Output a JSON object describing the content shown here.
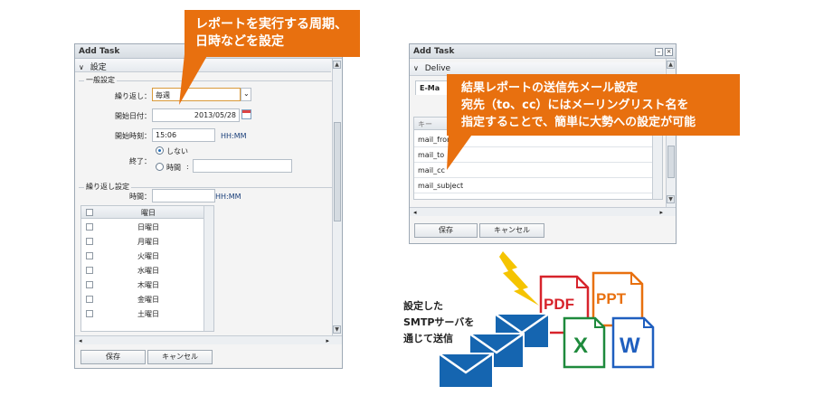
{
  "left_window": {
    "title": "Add Task",
    "section_header": "設定",
    "general_legend": "一般設定",
    "repeat_label": "繰り返し：",
    "repeat_value": "毎週",
    "start_date_label": "開始日付：",
    "start_date_value": "2013/05/28",
    "start_time_label": "開始時刻：",
    "start_time_value": "15:06",
    "time_unit": "HH:MM",
    "end_label": "終了：",
    "end_option_none": "しない",
    "end_option_time": "時間",
    "end_option_time_sep": ":",
    "repeat_settings_legend": "繰り返し設定",
    "interval_label": "時間：",
    "interval_unit": "HH:MM",
    "weekday_header": "曜日",
    "weekdays": [
      "日曜日",
      "月曜日",
      "火曜日",
      "水曜日",
      "木曜日",
      "金曜日",
      "土曜日"
    ],
    "save_button": "保存",
    "cancel_button": "キャンセル"
  },
  "right_window": {
    "title": "Add Task",
    "section_header": "Delive",
    "tab_label": "E-Ma",
    "grid_header": "キー",
    "mail_fields": [
      "mail_from",
      "mail_to",
      "mail_cc",
      "mail_subject"
    ],
    "save_button": "保存",
    "cancel_button": "キャンセル"
  },
  "callout_top": {
    "lines": [
      "レポートを実行する周期、",
      "日時などを設定"
    ]
  },
  "callout_right": {
    "lines": [
      "結果レポートの送信先メール設定",
      "宛先（to、cc）にはメーリングリスト名を",
      "指定することで、簡単に大勢への設定が可能"
    ]
  },
  "smtp_caption": {
    "lines": [
      "設定した",
      "SMTPサーバを",
      "通じて送信"
    ]
  },
  "file_icons": {
    "pdf": "PDF",
    "ppt": "PPT",
    "excel": "X",
    "word": "W"
  },
  "colors": {
    "callout": "#e8700f",
    "pdf": "#d7232b",
    "ppt": "#e8700f",
    "excel": "#1e8a3c",
    "word": "#1f5fbf",
    "envelope": "#1565b0",
    "bolt": "#f5c400"
  }
}
